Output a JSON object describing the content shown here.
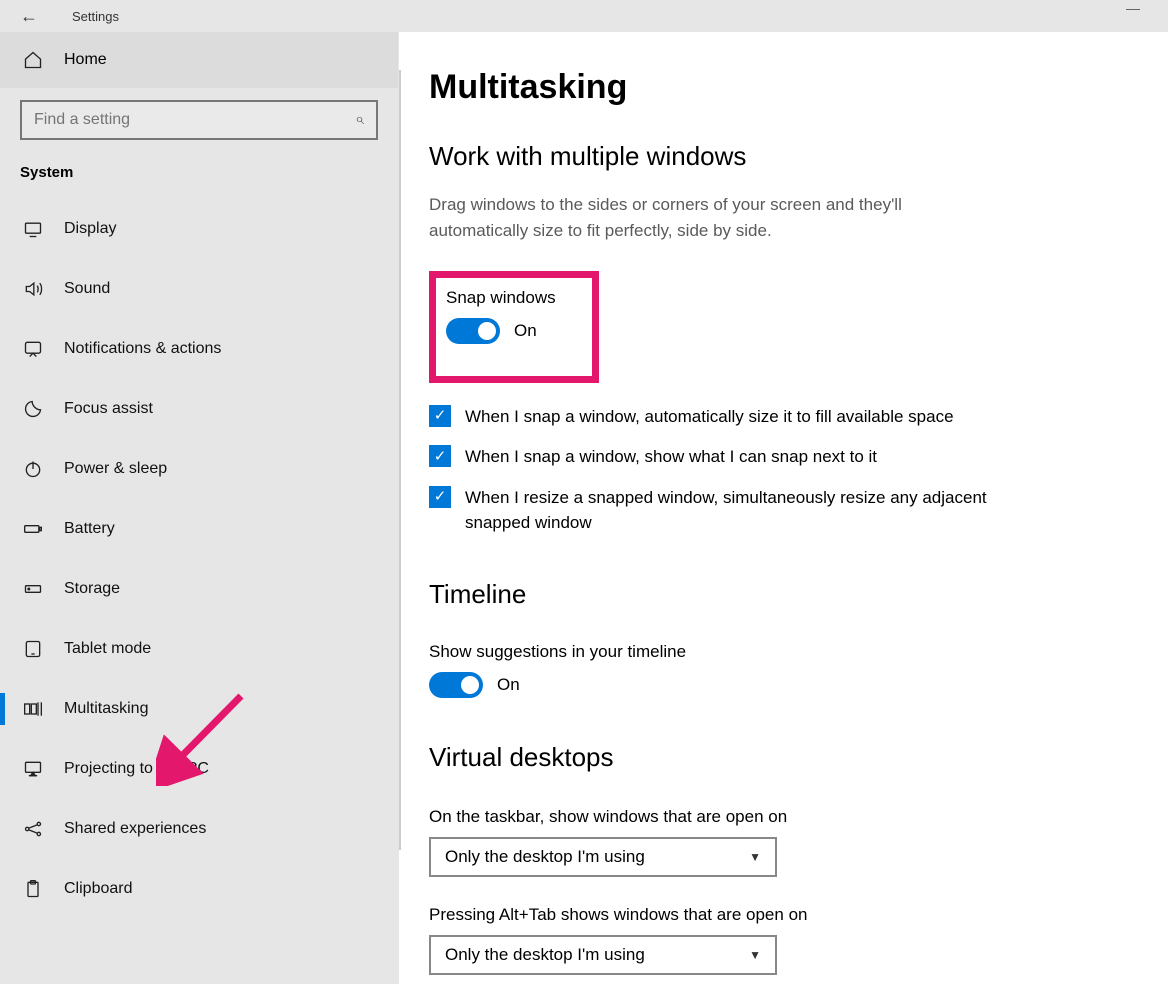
{
  "titlebar": {
    "title": "Settings"
  },
  "sidebar": {
    "home": "Home",
    "search_placeholder": "Find a setting",
    "category": "System",
    "items": [
      {
        "label": "Display"
      },
      {
        "label": "Sound"
      },
      {
        "label": "Notifications & actions"
      },
      {
        "label": "Focus assist"
      },
      {
        "label": "Power & sleep"
      },
      {
        "label": "Battery"
      },
      {
        "label": "Storage"
      },
      {
        "label": "Tablet mode"
      },
      {
        "label": "Multitasking",
        "selected": true
      },
      {
        "label": "Projecting to this PC"
      },
      {
        "label": "Shared experiences"
      },
      {
        "label": "Clipboard"
      }
    ]
  },
  "content": {
    "title": "Multitasking",
    "snap": {
      "heading": "Work with multiple windows",
      "description": "Drag windows to the sides or corners of your screen and they'll automatically size to fit perfectly, side by side.",
      "toggle_label": "Snap windows",
      "toggle_state": "On",
      "checks": [
        "When I snap a window, automatically size it to fill available space",
        "When I snap a window, show what I can snap next to it",
        "When I resize a snapped window, simultaneously resize any adjacent snapped window"
      ]
    },
    "timeline": {
      "heading": "Timeline",
      "toggle_label": "Show suggestions in your timeline",
      "toggle_state": "On"
    },
    "vdesk": {
      "heading": "Virtual desktops",
      "q1": "On the taskbar, show windows that are open on",
      "a1": "Only the desktop I'm using",
      "q2": "Pressing Alt+Tab shows windows that are open on",
      "a2": "Only the desktop I'm using"
    }
  },
  "annotation": {
    "highlight_color": "#e3186c",
    "arrow_color": "#e3186c"
  }
}
